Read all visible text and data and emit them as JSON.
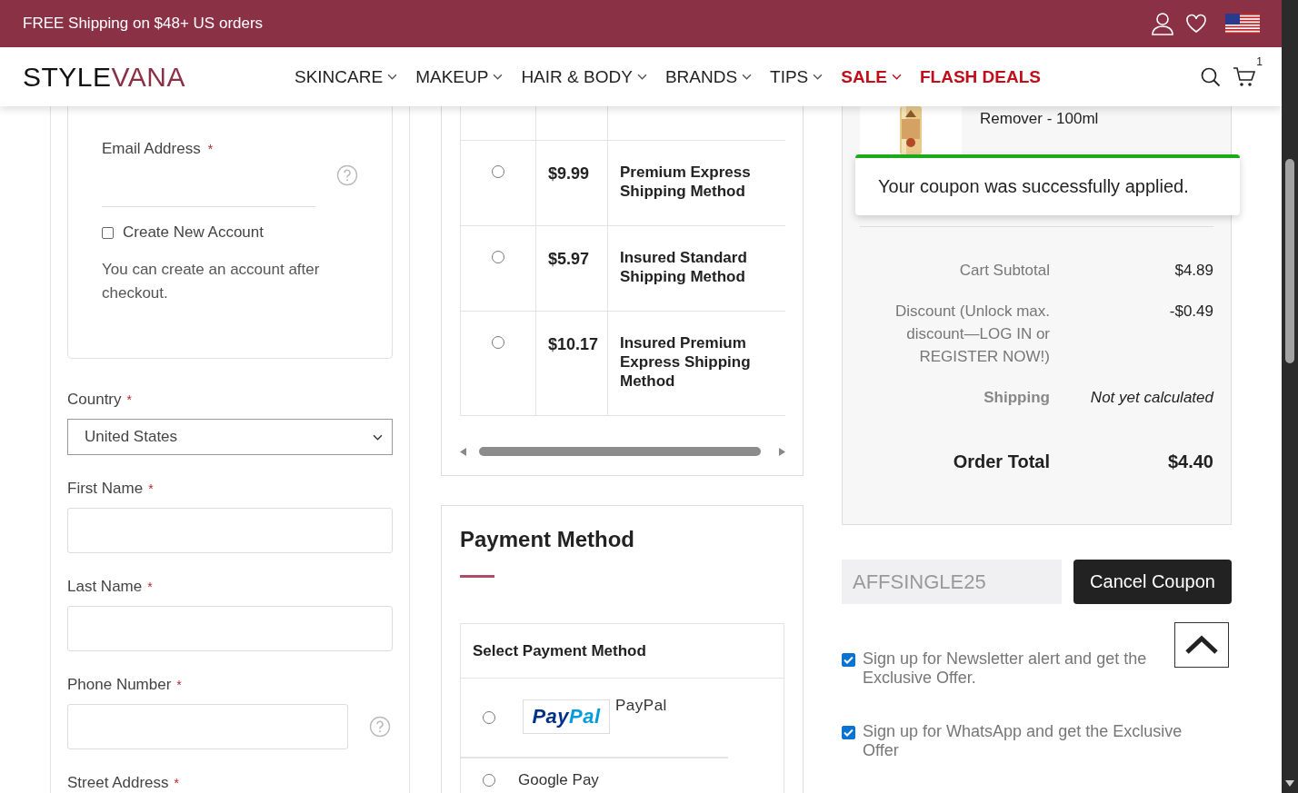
{
  "banner": {
    "text": "FREE Shipping on $48+ US orders"
  },
  "nav": {
    "logo_parts": [
      "STYLE",
      "VANA"
    ],
    "items": [
      {
        "label": "SKINCARE",
        "dropdown": true,
        "highlight": false
      },
      {
        "label": "MAKEUP",
        "dropdown": true,
        "highlight": false
      },
      {
        "label": "HAIR & BODY",
        "dropdown": true,
        "highlight": false
      },
      {
        "label": "BRANDS",
        "dropdown": true,
        "highlight": false
      },
      {
        "label": "TIPS",
        "dropdown": true,
        "highlight": false
      },
      {
        "label": "SALE",
        "dropdown": true,
        "highlight": true
      },
      {
        "label": "FLASH DEALS",
        "dropdown": false,
        "highlight": true
      }
    ],
    "cart_count": "1"
  },
  "account": {
    "email_label": "Email Address",
    "email_mark": "*",
    "create_account": {
      "label": "Create New Account",
      "checked": false
    },
    "note": "You can create an account after checkout."
  },
  "address_fields": [
    {
      "label": "Country",
      "mark": "*",
      "kind": "select",
      "value": "United States"
    },
    {
      "label": "First Name",
      "mark": "*",
      "kind": "input"
    },
    {
      "label": "Last Name",
      "mark": "*",
      "kind": "input"
    },
    {
      "label": "Phone Number",
      "mark": "*",
      "kind": "input_help"
    },
    {
      "label": "Street Address",
      "mark": "*",
      "kind": "label"
    }
  ],
  "shipping": {
    "rows": [
      {
        "price": "$9.99",
        "name": "Premium Express Shipping Method",
        "selected": false
      },
      {
        "price": "$5.97",
        "name": "Insured Standard Shipping Method",
        "selected": false
      },
      {
        "price": "$10.17",
        "name": "Insured Premium Express Shipping Method",
        "selected": false
      }
    ]
  },
  "payment": {
    "title": "Payment Method",
    "header": "Select Payment Method",
    "options": [
      {
        "kind": "logo",
        "logo_parts": [
          "Pay",
          "Pal"
        ],
        "label": "PayPal",
        "selected": false
      },
      {
        "kind": "plain",
        "label": "Google Pay",
        "selected": false
      }
    ]
  },
  "summary": {
    "product_name": "Remover - 100ml",
    "toast": "Your coupon was successfully applied.",
    "rows": [
      {
        "label": "Cart Subtotal",
        "value": "$4.89",
        "kind": "normal"
      },
      {
        "label": "Discount (Unlock max. discount—LOG IN or REGISTER NOW!)",
        "value": "-$0.49",
        "kind": "normal"
      },
      {
        "label": "Shipping",
        "value": "Not yet calculated",
        "kind": "pending"
      },
      {
        "label": "Order Total",
        "value": "$4.40",
        "kind": "total"
      }
    ]
  },
  "coupon": {
    "value": "AFFSINGLE25",
    "button": "Cancel Coupon"
  },
  "optins": [
    {
      "label": "Sign up for Newsletter alert and get the Exclusive Offer.",
      "checked": true
    },
    {
      "label": "Sign up for WhatsApp and get the Exclusive Offer",
      "checked": true
    }
  ]
}
